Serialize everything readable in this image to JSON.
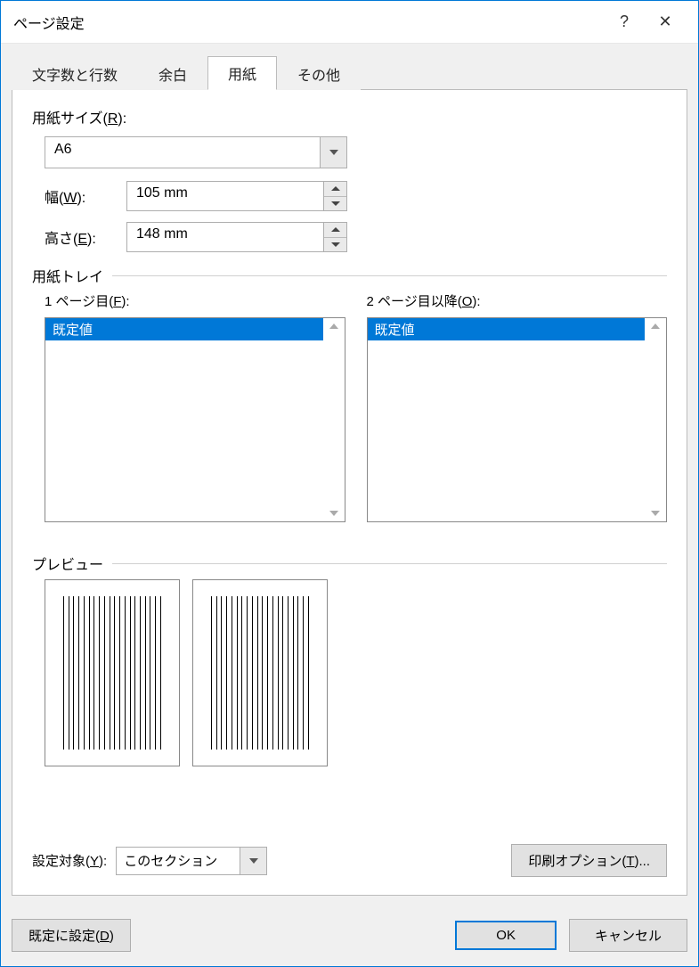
{
  "window": {
    "title": "ページ設定",
    "help": "?",
    "close": "✕"
  },
  "tabs": {
    "chars": "文字数と行数",
    "margins": "余白",
    "paper": "用紙",
    "other": "その他"
  },
  "paper": {
    "size_label_pre": "用紙サイズ(",
    "size_key": "R",
    "size_label_post": "):",
    "size_value": "A6",
    "width_label_pre": "幅(",
    "width_key": "W",
    "width_label_post": "):",
    "width_value": "105 mm",
    "height_label_pre": "高さ(",
    "height_key": "E",
    "height_label_post": "):",
    "height_value": "148 mm"
  },
  "tray": {
    "group_label": "用紙トレイ",
    "first_label_pre": "1 ページ目(",
    "first_key": "F",
    "first_label_post": "):",
    "other_label_pre": "2 ページ目以降(",
    "other_key": "O",
    "other_label_post": "):",
    "default_item": "既定値"
  },
  "preview": {
    "group_label": "プレビュー"
  },
  "apply": {
    "label_pre": "設定対象(",
    "key": "Y",
    "label_post": "):",
    "value": "このセクション",
    "print_opts_pre": "印刷オプション(",
    "print_opts_key": "T",
    "print_opts_post": ")..."
  },
  "buttons": {
    "set_default_pre": "既定に設定(",
    "set_default_key": "D",
    "set_default_post": ")",
    "ok": "OK",
    "cancel": "キャンセル"
  }
}
